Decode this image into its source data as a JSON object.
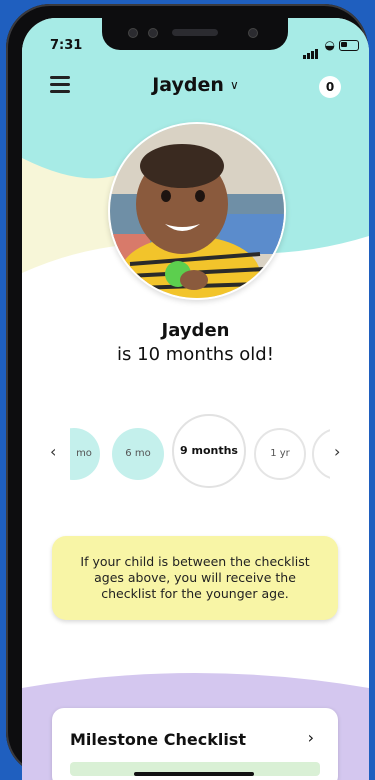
{
  "status_bar": {
    "time": "7:31"
  },
  "header": {
    "child_name": "Jayden",
    "badge_count": "0"
  },
  "profile": {
    "name": "Jayden",
    "age_text": "is 10 months old!"
  },
  "age_carousel": {
    "items": [
      {
        "label": "mo",
        "state": "partial"
      },
      {
        "label": "6 mo",
        "state": "completed"
      },
      {
        "label": "9 months",
        "state": "selected"
      },
      {
        "label": "1 yr",
        "state": "upcoming"
      },
      {
        "label": "",
        "state": "partial"
      }
    ]
  },
  "notice": {
    "text": "If your child is between the checklist ages above, you will receive the checklist for the younger age."
  },
  "milestone_card": {
    "title": "Milestone Checklist"
  },
  "colors": {
    "hero_teal": "#a7ebe6",
    "hero_cream": "#f7f6d8",
    "notice_yellow": "#f8f5a6",
    "bottom_purple": "#d4c7ef",
    "circle_teal": "#c4f0ec"
  }
}
